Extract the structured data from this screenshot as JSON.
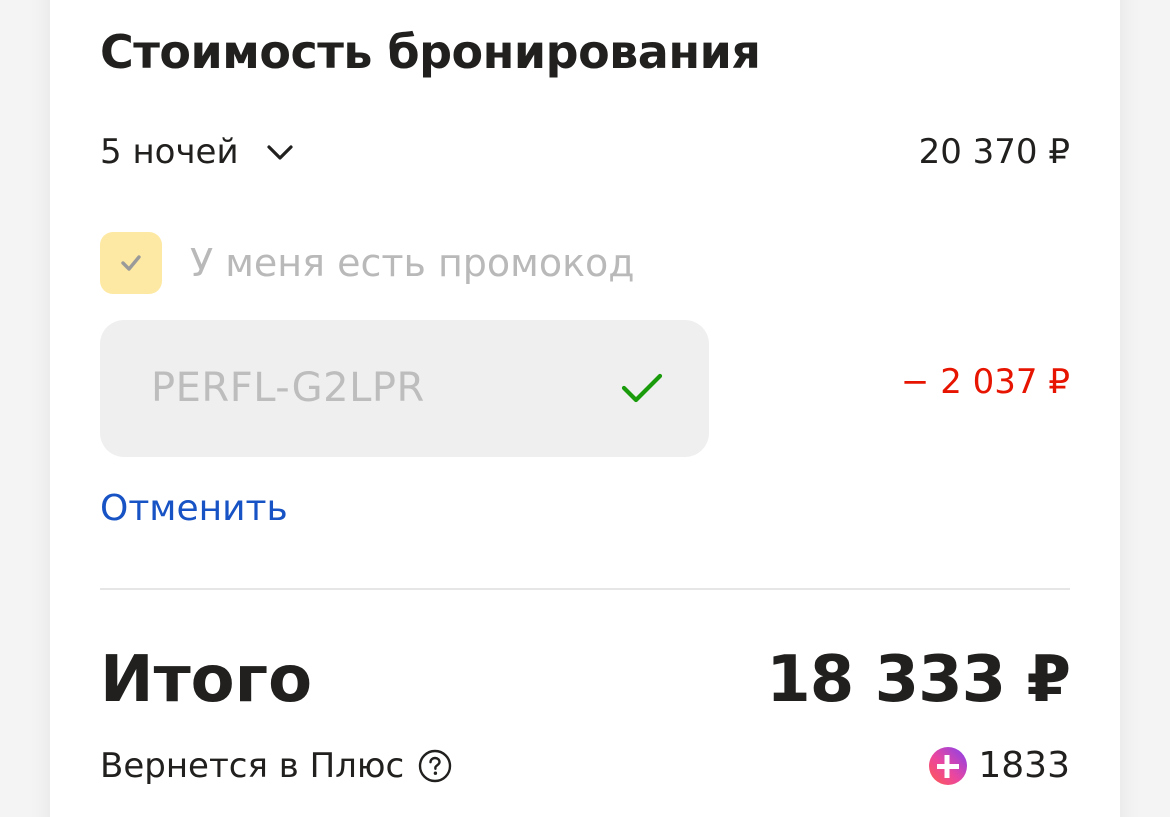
{
  "booking": {
    "title": "Стоимость бронирования",
    "nights_label": "5 ночей",
    "nights_price": "20 370 ₽",
    "promo_checkbox_label": "У меня есть промокод",
    "promo_checkbox_checked": true,
    "promo_code": "PERFL-G2LPR",
    "promo_discount": "− 2 037 ₽",
    "cancel_label": "Отменить",
    "total_label": "Итого",
    "total_value": "18 333 ₽",
    "cashback_label": "Вернется в Плюс",
    "plus_points": "1833"
  },
  "icons": {
    "chevron": "chevron-down-icon",
    "checkbox_mark": "check-icon",
    "promo_valid": "check-icon",
    "help": "question-circle-icon",
    "plus": "yandex-plus-icon"
  },
  "colors": {
    "checkbox_bg": "#fde9a3",
    "valid_check": "#1a9b0c",
    "discount": "#e61400",
    "link": "#1753c4"
  }
}
